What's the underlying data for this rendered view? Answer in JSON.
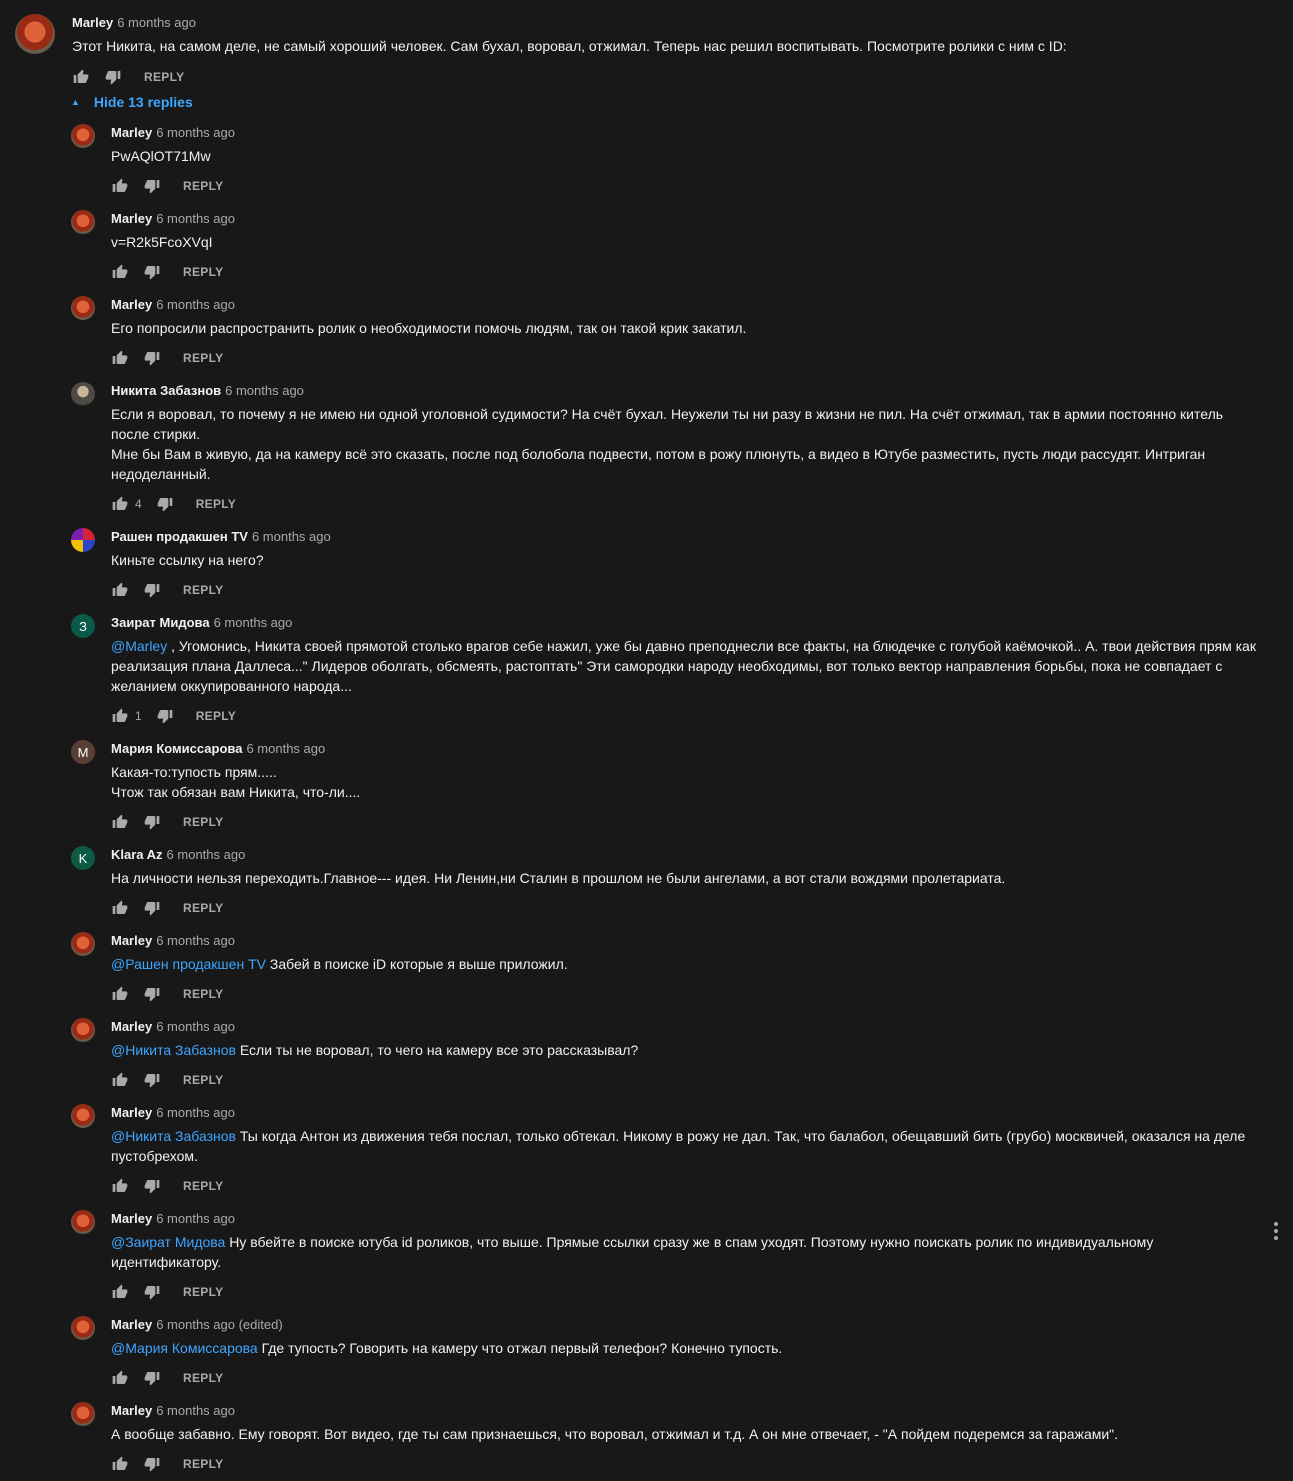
{
  "main_comment": {
    "author": "Marley",
    "time": "6 months ago",
    "text": "Этот Никита, на самом деле, не самый хороший человек. Сам бухал, воровал, отжимал. Теперь нас решил воспитывать. Посмотрите ролики с ним с ID:",
    "reply_label": "REPLY"
  },
  "replies_toggle": {
    "label": "Hide 13 replies"
  },
  "replies": [
    {
      "author": "Marley",
      "time": "6 months ago",
      "avatar": "marley",
      "mention": "",
      "text": "PwAQlOT71Mw",
      "likes": "",
      "reply_label": "REPLY"
    },
    {
      "author": "Marley",
      "time": "6 months ago",
      "avatar": "marley",
      "mention": "",
      "text": "v=R2k5FcoXVqI",
      "likes": "",
      "reply_label": "REPLY"
    },
    {
      "author": "Marley",
      "time": "6 months ago",
      "avatar": "marley",
      "mention": "",
      "text": "Его попросили распространить ролик о необходимости помочь людям, так он такой крик закатил.",
      "likes": "",
      "reply_label": "REPLY"
    },
    {
      "author": "Никита Забазнов",
      "time": "6 months ago",
      "avatar": "nikita",
      "mention": "",
      "text": "Если я воровал, то почему я не имею ни одной уголовной судимости? На счёт бухал. Неужели ты ни разу в жизни не пил. На счёт отжимал, так в армии постоянно китель после стирки.",
      "text2": "Мне бы Вам в живую, да на камеру всё это сказать, после под болобола подвести, потом в рожу плюнуть, а видео в Ютубе разместить, пусть люди рассудят. Интриган недоделанный.",
      "likes": "4",
      "reply_label": "REPLY"
    },
    {
      "author": "Рашен продакшен TV",
      "time": "6 months ago",
      "avatar": "rashen",
      "mention": "",
      "text": "Киньте ссылку на него?",
      "likes": "",
      "reply_label": "REPLY"
    },
    {
      "author": "Заират Мидова",
      "time": "6 months ago",
      "avatar": "zairat",
      "avatar_letter": "З",
      "mention": "@Marley",
      "text": " , Угомонись, Никита своей прямотой столько врагов себе нажил, уже бы давно преподнесли  все факты, на блюдечке с голубой каёмочкой.. А. твои действия прям как реализация плана Даллеса...\" Лидеров оболгать, обсмеять, растоптать\" Эти самородки народу необходимы, вот только вектор направления борьбы,  пока не совпадает с желанием оккупированного народа...",
      "likes": "1",
      "reply_label": "REPLY"
    },
    {
      "author": "Мария Комиссарова",
      "time": "6 months ago",
      "avatar": "maria",
      "avatar_letter": "М",
      "mention": "",
      "text": "Какая-то:тупость прям.....",
      "text2": "Чтож так обязан вам Никита, что-ли....",
      "likes": "",
      "reply_label": "REPLY"
    },
    {
      "author": "Klara Az",
      "time": "6 months ago",
      "avatar": "klara",
      "avatar_letter": "K",
      "mention": "",
      "text": "На личности нельзя переходить.Главное--- идея. Ни Ленин,ни Сталин в прошлом не были ангелами, а вот стали вождями пролетариата.",
      "likes": "",
      "reply_label": "REPLY"
    },
    {
      "author": "Marley",
      "time": "6 months ago",
      "avatar": "marley",
      "mention": "@Рашен продакшен TV",
      "text": " Забей в поиске iD которые я выше приложил.",
      "likes": "",
      "reply_label": "REPLY"
    },
    {
      "author": "Marley",
      "time": "6 months ago",
      "avatar": "marley",
      "mention": "@Никита Забазнов",
      "text": " Если ты не воровал, то чего на камеру все это рассказывал?",
      "likes": "",
      "reply_label": "REPLY"
    },
    {
      "author": "Marley",
      "time": "6 months ago",
      "avatar": "marley",
      "mention": "@Никита Забазнов",
      "text": " Ты когда Антон из движения тебя послал, только обтекал. Никому в рожу не дал. Так, что балабол, обещавший бить (грубо) москвичей, оказался на деле пустобрехом.",
      "likes": "",
      "reply_label": "REPLY"
    },
    {
      "author": "Marley",
      "time": "6 months ago",
      "avatar": "marley",
      "mention": "@Заират Мидова",
      "text": " Ну вбейте в поиске ютуба id роликов, что выше.  Прямые ссылки сразу же в спам уходят. Поэтому нужно поискать ролик по индивидуальному идентификатору.",
      "likes": "",
      "reply_label": "REPLY"
    },
    {
      "author": "Marley",
      "time": "6 months ago (edited)",
      "avatar": "marley",
      "mention": "@Мария Комиссарова",
      "text": " Где тупость? Говорить на камеру что отжал первый телефон? Конечно тупость.",
      "likes": "",
      "reply_label": "REPLY"
    },
    {
      "author": "Marley",
      "time": "6 months ago",
      "avatar": "marley",
      "mention": "",
      "text": "А вообще забавно. Ему говорят. Вот видео, где ты сам признаешься, что воровал, отжимал и т.д. А он мне отвечает, - \"А пойдем подеремся за гаражами\".",
      "likes": "",
      "reply_label": "REPLY"
    }
  ],
  "icons": {
    "like": "thumbs-up-icon",
    "dislike": "thumbs-down-icon",
    "more": "more-vert-icon",
    "caret": "caret-up-icon"
  },
  "colors": {
    "background": "#181818",
    "text": "#f1f1f1",
    "secondary": "#aaaaaa",
    "link": "#3ea6ff"
  }
}
